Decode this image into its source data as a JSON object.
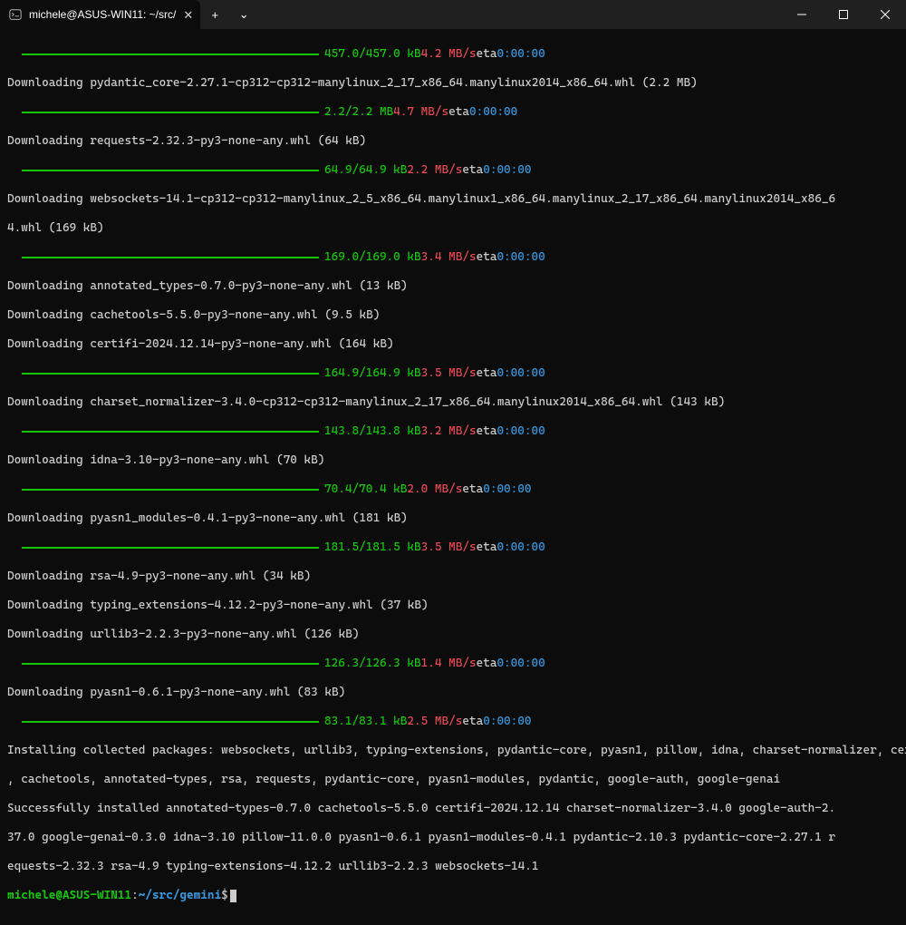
{
  "titlebar": {
    "tab_icon": "terminal",
    "tab_title": "michele@ASUS-WIN11: ~/src/",
    "add_label": "+",
    "chevron_label": "⌄"
  },
  "progress": [
    {
      "size": "457.0/457.0 kB",
      "speed": "4.2 MB/s",
      "eta_label": "eta",
      "eta": "0:00:00"
    },
    {
      "size": "2.2/2.2 MB",
      "speed": "4.7 MB/s",
      "eta_label": "eta",
      "eta": "0:00:00"
    },
    {
      "size": "64.9/64.9 kB",
      "speed": "2.2 MB/s",
      "eta_label": "eta",
      "eta": "0:00:00"
    },
    {
      "size": "169.0/169.0 kB",
      "speed": "3.4 MB/s",
      "eta_label": "eta",
      "eta": "0:00:00"
    },
    {
      "size": "164.9/164.9 kB",
      "speed": "3.5 MB/s",
      "eta_label": "eta",
      "eta": "0:00:00"
    },
    {
      "size": "143.8/143.8 kB",
      "speed": "3.2 MB/s",
      "eta_label": "eta",
      "eta": "0:00:00"
    },
    {
      "size": "70.4/70.4 kB",
      "speed": "2.0 MB/s",
      "eta_label": "eta",
      "eta": "0:00:00"
    },
    {
      "size": "181.5/181.5 kB",
      "speed": "3.5 MB/s",
      "eta_label": "eta",
      "eta": "0:00:00"
    },
    {
      "size": "126.3/126.3 kB",
      "speed": "1.4 MB/s",
      "eta_label": "eta",
      "eta": "0:00:00"
    },
    {
      "size": "83.1/83.1 kB",
      "speed": "2.5 MB/s",
      "eta_label": "eta",
      "eta": "0:00:00"
    }
  ],
  "lines": {
    "d0": "Downloading pydantic_core-2.27.1-cp312-cp312-manylinux_2_17_x86_64.manylinux2014_x86_64.whl (2.2 MB)",
    "d1": "Downloading requests-2.32.3-py3-none-any.whl (64 kB)",
    "d2a": "Downloading websockets-14.1-cp312-cp312-manylinux_2_5_x86_64.manylinux1_x86_64.manylinux_2_17_x86_64.manylinux2014_x86_6",
    "d2b": "4.whl (169 kB)",
    "d3": "Downloading annotated_types-0.7.0-py3-none-any.whl (13 kB)",
    "d4": "Downloading cachetools-5.5.0-py3-none-any.whl (9.5 kB)",
    "d5": "Downloading certifi-2024.12.14-py3-none-any.whl (164 kB)",
    "d6": "Downloading charset_normalizer-3.4.0-cp312-cp312-manylinux_2_17_x86_64.manylinux2014_x86_64.whl (143 kB)",
    "d7": "Downloading idna-3.10-py3-none-any.whl (70 kB)",
    "d8": "Downloading pyasn1_modules-0.4.1-py3-none-any.whl (181 kB)",
    "d9": "Downloading rsa-4.9-py3-none-any.whl (34 kB)",
    "d10": "Downloading typing_extensions-4.12.2-py3-none-any.whl (37 kB)",
    "d11": "Downloading urllib3-2.2.3-py3-none-any.whl (126 kB)",
    "d12": "Downloading pyasn1-0.6.1-py3-none-any.whl (83 kB)",
    "inst1": "Installing collected packages: websockets, urllib3, typing-extensions, pydantic-core, pyasn1, pillow, idna, charset-normalizer, certifi",
    "inst2": ", cachetools, annotated-types, rsa, requests, pydantic-core, pyasn1-modules, pydantic, google-auth, google-genai",
    "succ1": "Successfully installed annotated-types-0.7.0 cachetools-5.5.0 certifi-2024.12.14 charset-normalizer-3.4.0 google-auth-2.",
    "succ2": "37.0 google-genai-0.3.0 idna-3.10 pillow-11.0.0 pyasn1-0.6.1 pyasn1-modules-0.4.1 pydantic-2.10.3 pydantic-core-2.27.1 r",
    "succ3": "equests-2.32.3 rsa-4.9 typing-extensions-4.12.2 urllib3-2.2.3 websockets-14.1"
  },
  "prompt": {
    "user_host": "michele@ASUS-WIN11",
    "colon": ":",
    "path": "~/src/gemini",
    "symbol": "$"
  }
}
